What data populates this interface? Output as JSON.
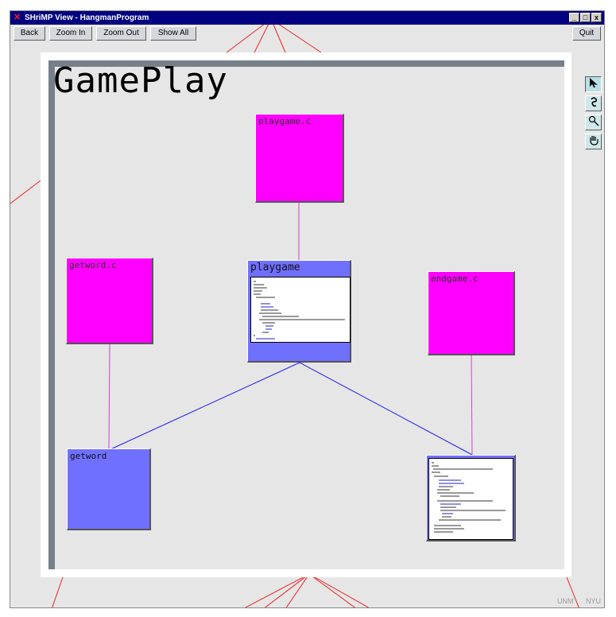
{
  "window": {
    "title": "SHriMP View - HangmanProgram",
    "controls": {
      "minimize": "_",
      "maximize": "□",
      "close": "x"
    }
  },
  "toolbar": {
    "back_label": "Back",
    "zoom_in_label": "Zoom In",
    "zoom_out_label": "Zoom Out",
    "show_all_label": "Show All",
    "quit_label": "Quit"
  },
  "panel": {
    "title": "GamePlay",
    "nodes": [
      {
        "label": "playgame.c",
        "kind": "file"
      },
      {
        "label": "getword.c",
        "kind": "file"
      },
      {
        "label": "playgame",
        "kind": "function"
      },
      {
        "label": "endgame.c",
        "kind": "file"
      },
      {
        "label": "getword",
        "kind": "function"
      },
      {
        "label": "",
        "kind": "function"
      }
    ]
  },
  "tools": [
    {
      "name": "arrow-select-tool",
      "icon": "arrow-icon",
      "active": true
    },
    {
      "name": "lasso-tool",
      "icon": "lasso-icon",
      "active": false
    },
    {
      "name": "magnify-tool",
      "icon": "magnifier-icon",
      "active": false
    },
    {
      "name": "pan-tool",
      "icon": "hand-icon",
      "active": false
    }
  ],
  "footer": {
    "left": "UNM",
    "right": "NYU"
  },
  "colors": {
    "title_bar": "#000080",
    "file_node": "#ff00ff",
    "function_node": "#7070ff",
    "panel_border": "#75808a",
    "background": "#e6e6e6",
    "file_edge": "#cc44cc",
    "call_edge": "#2020ee",
    "outer_edge": "#ee2222"
  }
}
